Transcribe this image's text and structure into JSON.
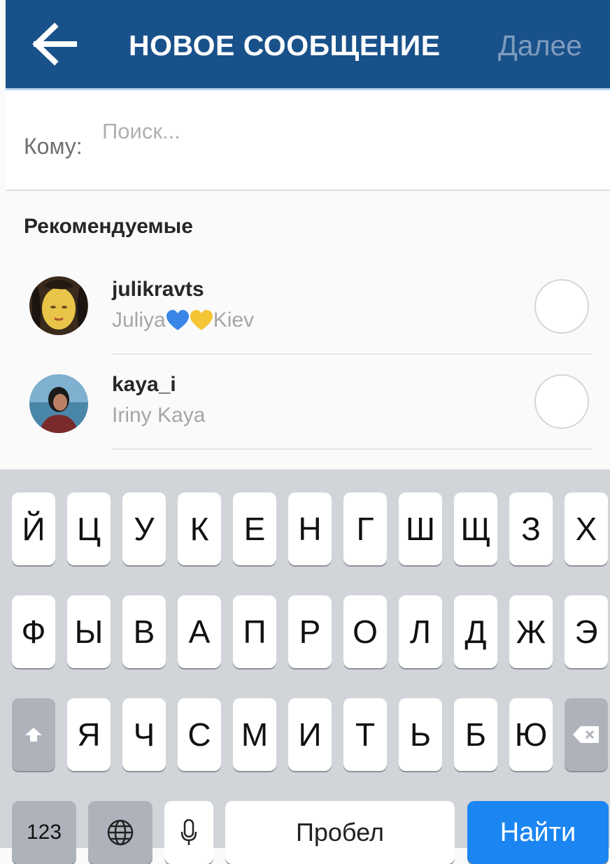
{
  "header": {
    "back_icon": "arrow-left-icon",
    "title": "НОВОЕ СООБЩЕНИЕ",
    "next_label": "Далее"
  },
  "recipient": {
    "label": "Кому:",
    "placeholder": "Поиск..."
  },
  "suggested": {
    "title": "Рекомендуемые",
    "users": [
      {
        "username": "julikravts",
        "name_start": "Juliya",
        "name_icons": [
          "blue-heart-icon",
          "yellow-heart-icon"
        ],
        "name_end": "Kiev"
      },
      {
        "username": "kaya_i",
        "name": "Iriny Kaya"
      }
    ]
  },
  "keyboard": {
    "row1": [
      "Й",
      "Ц",
      "У",
      "К",
      "Е",
      "Н",
      "Г",
      "Ш",
      "Щ",
      "З",
      "Х"
    ],
    "row2": [
      "Ф",
      "Ы",
      "В",
      "А",
      "П",
      "Р",
      "О",
      "Л",
      "Д",
      "Ж",
      "Э"
    ],
    "row3": [
      "Я",
      "Ч",
      "С",
      "М",
      "И",
      "Т",
      "Ь",
      "Б",
      "Ю"
    ],
    "shift_icon": "shift-icon",
    "delete_icon": "backspace-icon",
    "numbers_label": "123",
    "globe_icon": "globe-icon",
    "mic_icon": "microphone-icon",
    "space_label": "Пробел",
    "go_label": "Найти"
  },
  "colors": {
    "header_bg": "#19518a",
    "go_key": "#1b86f2"
  }
}
